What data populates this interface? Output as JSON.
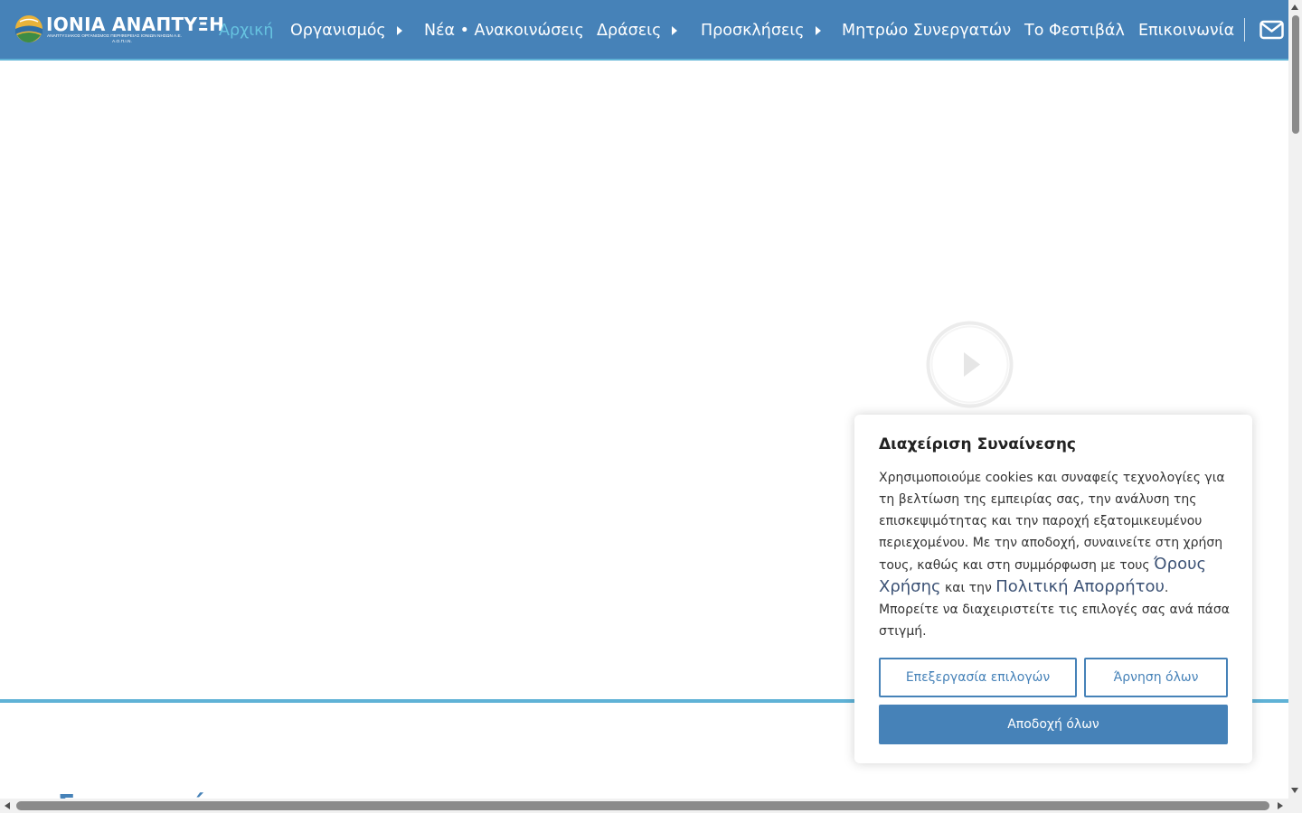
{
  "brand": {
    "title": "ΙΟΝΙΑ ΑΝΑΠΤΥΞΗ",
    "subtitle_line1": "ΑΝΑΠΤΥΞΙΑΚΟΣ ΟΡΓΑΝΙΣΜΟΣ ΠΕΡΙΦΕΡΕΙΑΣ ΙΟΝΙΩΝ ΝΗΣΩΝ Α.Ε.",
    "subtitle_line2": "Α.Ο.Π.Ι.Ν.",
    "icon": "logo-globe-icon"
  },
  "nav": {
    "items": [
      {
        "label": "Αρχική",
        "active": true
      },
      {
        "label": "Οργανισμός",
        "has_submenu": true
      },
      {
        "label": "Νέα • Ανακοινώσεις"
      },
      {
        "label": "Δράσεις",
        "has_submenu": true
      },
      {
        "label": "Προσκλήσεις",
        "has_submenu": true
      },
      {
        "label": "Μητρώο Συνεργατών"
      },
      {
        "label": "Το Φεστιβάλ"
      },
      {
        "label": "Επικοινωνία"
      }
    ],
    "mail_icon": "envelope-icon"
  },
  "hero": {
    "play_icon": "play-icon"
  },
  "section": {
    "heading": "Σημαντικά"
  },
  "cookie": {
    "title": "Διαχείριση Συναίνεσης",
    "text_before": "Χρησιμοποιούμε cookies και συναφείς τεχνολογίες για τη βελτίωση της εμπειρίας σας, την ανάλυση της επισκεψιμότητας και την παροχή εξατομικευμένου περιεχομένου. Με την αποδοχή, συναινείτε στη χρήση τους, καθώς και στη συμμόρφωση με τους ",
    "terms_link": "Όρους Χρήσης",
    "text_mid": " και την ",
    "privacy_link": "Πολιτική Απορρήτου",
    "text_after": ". Μπορείτε να διαχειριστείτε τις επιλογές σας ανά πάσα στιγμή.",
    "edit_button": "Επεξεργασία επιλογών",
    "reject_button": "Άρνηση όλων",
    "accept_button": "Αποδοχή όλων"
  },
  "colors": {
    "primary": "#4682b8",
    "accent": "#5fb2d6",
    "active_nav": "#66c3e0",
    "link": "#3c5275"
  }
}
